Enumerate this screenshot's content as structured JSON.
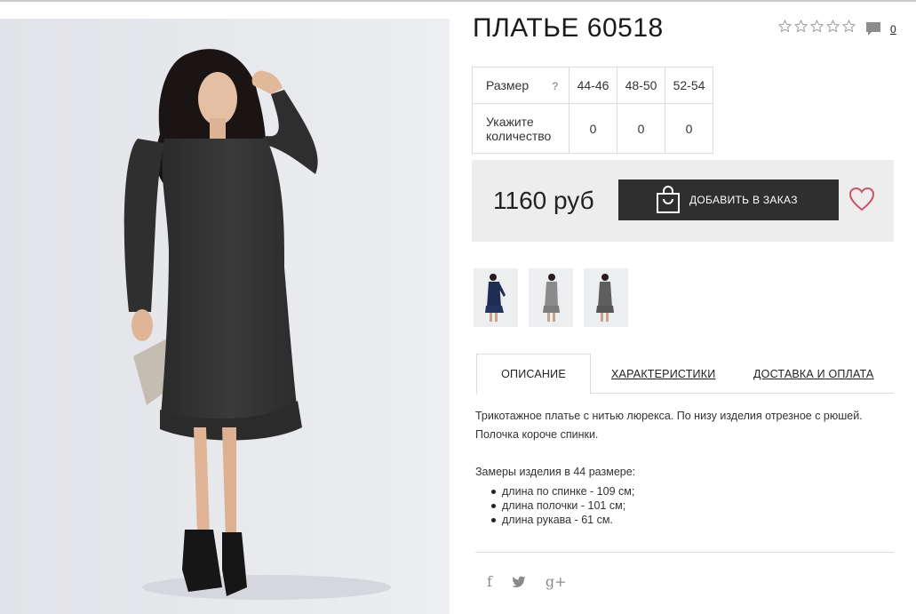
{
  "product": {
    "title": "ПЛАТЬЕ 60518",
    "rating_stars": 5,
    "rating_value": 0,
    "comment_count": "0"
  },
  "size_table": {
    "size_label": "Размер",
    "help": "?",
    "sizes": [
      "44-46",
      "48-50",
      "52-54"
    ],
    "qty_label_line1": "Укажите",
    "qty_label_line2": "количество",
    "quantities": [
      "0",
      "0",
      "0"
    ]
  },
  "purchase": {
    "price": "1160 руб",
    "add_button": "ДОБАВИТЬ В ЗАКАЗ"
  },
  "thumbnails": [
    {
      "icon": "dress-navy-thumbnail"
    },
    {
      "icon": "dress-grey-thumbnail"
    },
    {
      "icon": "dress-darkgrey-thumbnail"
    }
  ],
  "tabs": {
    "description": "ОПИСАНИЕ",
    "specs": "ХАРАКТЕРИСТИКИ",
    "delivery": "ДОСТАВКА И ОПЛАТА"
  },
  "description": {
    "text": "Трикотажное платье с нитью люрекса. По низу изделия отрезное с рюшей. Полочка короче спинки.",
    "measure_title": "Замеры изделия в 44 размере:",
    "measures": [
      "длина по спинке - 109 см;",
      "длина полочки - 101 см;",
      "длина рукава - 61 см."
    ]
  },
  "social": {
    "facebook": "f",
    "twitter": "🐦",
    "google_plus": "g+"
  },
  "colors": {
    "button_bg": "#2f2f2f",
    "price_box_bg": "#ededed",
    "heart": "#c8566b",
    "photo_bg": "#e7e8ec"
  }
}
